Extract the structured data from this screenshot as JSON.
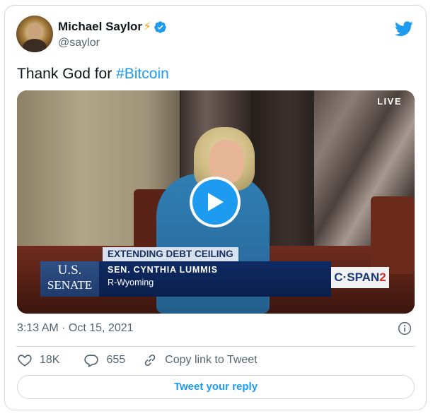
{
  "author": {
    "display_name": "Michael Saylor",
    "emoji": "⚡",
    "handle": "@saylor",
    "verified_icon": "verified-badge-icon",
    "avatar_icon": "avatar"
  },
  "brand": {
    "logo_icon": "twitter-bird-icon",
    "accent_color": "#1d9bf0"
  },
  "tweet": {
    "text_prefix": "Thank God for ",
    "hashtag": "#Bitcoin"
  },
  "media": {
    "live_label": "LIVE",
    "headline": "EXTENDING DEBT CEILING",
    "senate_us": "U.S.",
    "senate_word": "SENATE",
    "speaker_name": "SEN. CYNTHIA LUMMIS",
    "speaker_title": "R-Wyoming",
    "network_prefix": "C·SPAN",
    "network_number": "2",
    "play_icon": "play-icon"
  },
  "meta": {
    "timestamp": "3:13 AM · Oct 15, 2021",
    "info_icon": "info-icon"
  },
  "actions": {
    "likes": "18K",
    "replies": "655",
    "copy_link": "Copy link to Tweet",
    "reply_button": "Tweet your reply"
  }
}
